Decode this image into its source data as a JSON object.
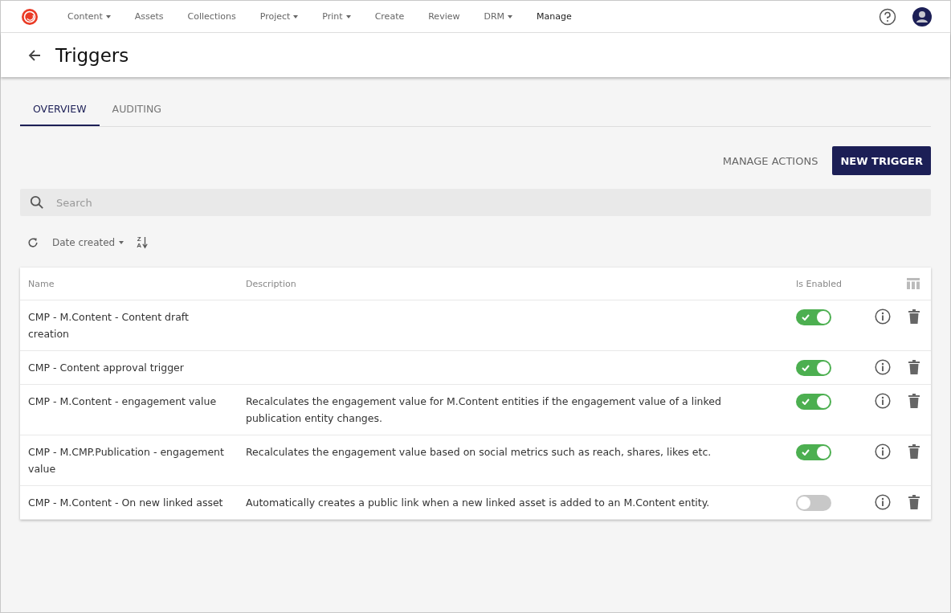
{
  "nav": [
    {
      "label": "Content",
      "dropdown": true,
      "selected": false
    },
    {
      "label": "Assets",
      "dropdown": false,
      "selected": false
    },
    {
      "label": "Collections",
      "dropdown": false,
      "selected": false
    },
    {
      "label": "Project",
      "dropdown": true,
      "selected": false
    },
    {
      "label": "Print",
      "dropdown": true,
      "selected": false
    },
    {
      "label": "Create",
      "dropdown": false,
      "selected": false
    },
    {
      "label": "Review",
      "dropdown": false,
      "selected": false
    },
    {
      "label": "DRM",
      "dropdown": true,
      "selected": false
    },
    {
      "label": "Manage",
      "dropdown": false,
      "selected": true
    }
  ],
  "page_title": "Triggers",
  "tabs": [
    {
      "label": "OVERVIEW",
      "selected": true
    },
    {
      "label": "AUDITING",
      "selected": false
    }
  ],
  "actions": {
    "secondary": "MANAGE ACTIONS",
    "primary": "NEW TRIGGER"
  },
  "search": {
    "placeholder": "Search"
  },
  "sort": {
    "label": "Date created",
    "order_top": "Z",
    "order_bottom": "A"
  },
  "table": {
    "columns": [
      "Name",
      "Description",
      "Is Enabled"
    ],
    "rows": [
      {
        "name": "CMP - M.Content - Content draft creation",
        "enabled": true
      },
      {
        "name": "CMP - Content approval trigger",
        "enabled": true
      },
      {
        "name": "CMP - M.Content - engagement value",
        "description": "Recalculates the engagement value for M.Content entities if the engagement value of a linked publication entity changes.",
        "enabled": true
      },
      {
        "name": "CMP - M.CMP.Publication - engagement value",
        "description": "Recalculates the engagement value based on social metrics such as reach, shares, likes etc.",
        "enabled": true
      },
      {
        "name": "CMP - M.Content - On new linked asset",
        "description": "Automatically creates a public link when a new linked asset is added to an M.Content entity.",
        "enabled": false
      }
    ]
  }
}
